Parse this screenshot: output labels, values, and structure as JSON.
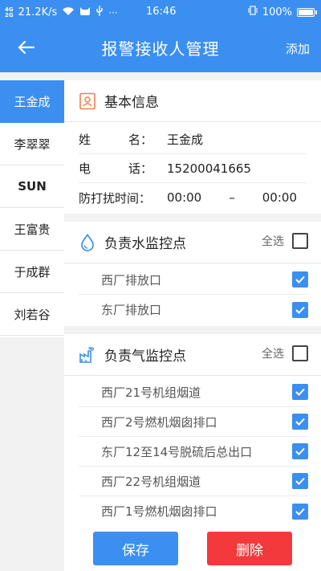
{
  "statusbar": {
    "network": "4G",
    "network2": "2G",
    "speed": "21.2K/s",
    "time": "16:46",
    "battery": "100%"
  },
  "appbar": {
    "title": "报警接收人管理",
    "add_label": "添加"
  },
  "sidebar": {
    "items": [
      {
        "label": "王金成"
      },
      {
        "label": "李翠翠"
      },
      {
        "label": "SUN"
      },
      {
        "label": "王富贵"
      },
      {
        "label": "于成群"
      },
      {
        "label": "刘若谷"
      }
    ]
  },
  "basic": {
    "title": "基本信息",
    "name_label_1": "姓",
    "name_label_2": "名：",
    "name_value": "王金成",
    "phone_label_1": "电",
    "phone_label_2": "话：",
    "phone_value": "15200041665",
    "dnd_label": "防打扰时间：",
    "dnd_start": "00:00",
    "dnd_sep": "–",
    "dnd_end": "00:00"
  },
  "water": {
    "title": "负责水监控点",
    "select_all": "全选",
    "select_all_checked": false,
    "items": [
      {
        "label": "西厂排放口",
        "checked": true
      },
      {
        "label": "东厂排放口",
        "checked": true
      }
    ]
  },
  "gas": {
    "title": "负责气监控点",
    "select_all": "全选",
    "select_all_checked": false,
    "items": [
      {
        "label": "西厂21号机组烟道",
        "checked": true
      },
      {
        "label": "西厂2号燃机烟囱排口",
        "checked": true
      },
      {
        "label": "东厂12至14号脱硫后总出口",
        "checked": true
      },
      {
        "label": "西厂22号机组烟道",
        "checked": true
      },
      {
        "label": "西厂1号燃机烟囱排口",
        "checked": true
      }
    ]
  },
  "buttons": {
    "save": "保存",
    "delete": "删除"
  },
  "colors": {
    "primary": "#3b8ff0",
    "danger": "#f4393d"
  }
}
